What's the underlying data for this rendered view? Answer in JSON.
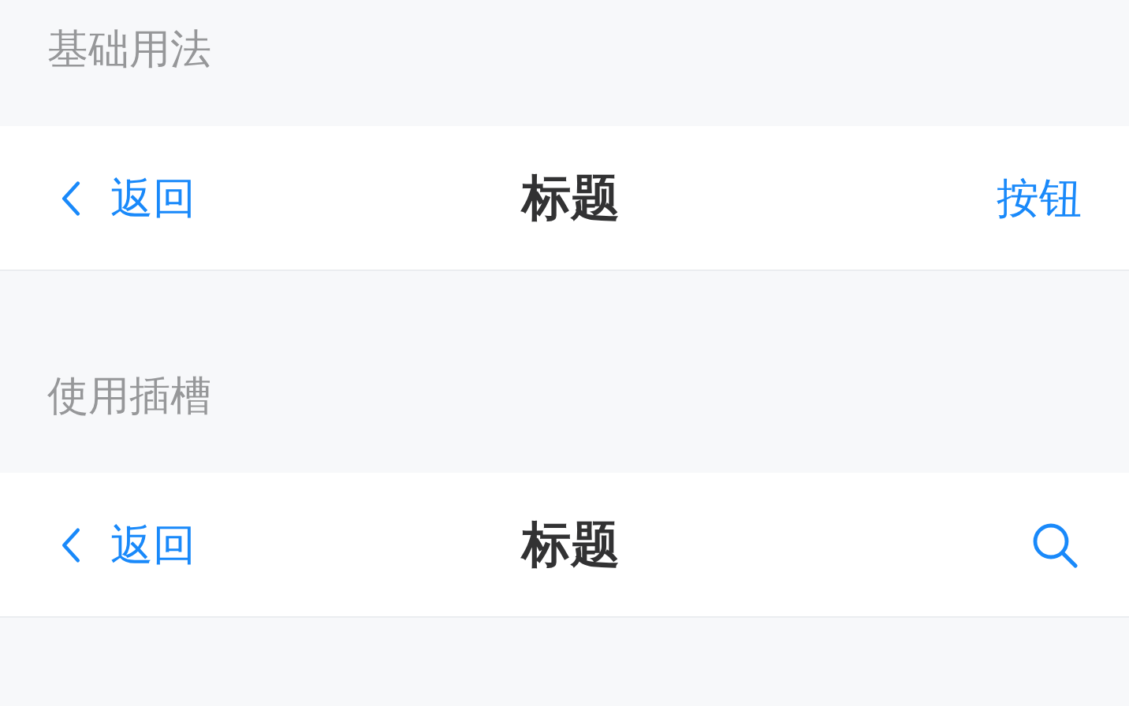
{
  "sections": [
    {
      "title": "基础用法",
      "nav_bar": {
        "back_label": "返回",
        "title": "标题",
        "right": {
          "kind": "text",
          "label": "按钮"
        }
      }
    },
    {
      "title": "使用插槽",
      "nav_bar": {
        "back_label": "返回",
        "title": "标题",
        "right": {
          "kind": "search"
        }
      }
    }
  ]
}
